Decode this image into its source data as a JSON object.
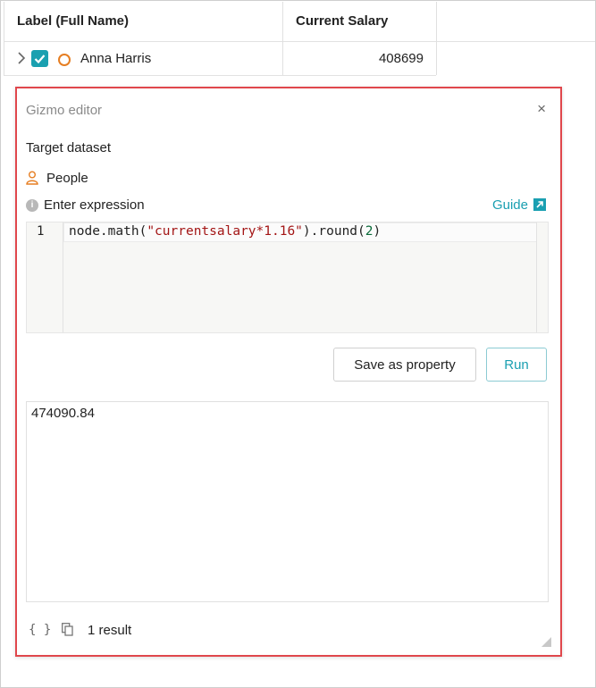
{
  "table": {
    "columns": [
      "Label (Full Name)",
      "Current Salary"
    ],
    "rows": [
      {
        "name": "Anna Harris",
        "salary": "408699",
        "checked": true
      }
    ]
  },
  "gizmo": {
    "title": "Gizmo editor",
    "close_label": "×",
    "target_label": "Target dataset",
    "dataset": "People",
    "expression_label": "Enter expression",
    "guide_label": "Guide",
    "line_number": "1",
    "code": {
      "prefix": "node.math(",
      "string": "\"currentsalary*1.16\"",
      "middle": ").round(",
      "number": "2",
      "suffix": ")"
    },
    "save_label": "Save as property",
    "run_label": "Run",
    "result_value": "474090.84",
    "braces_label": "{ }",
    "result_count": "1 result"
  },
  "colors": {
    "accent": "#1a9fb1",
    "highlight_border": "#e0474c",
    "node_ring": "#e67e22"
  }
}
